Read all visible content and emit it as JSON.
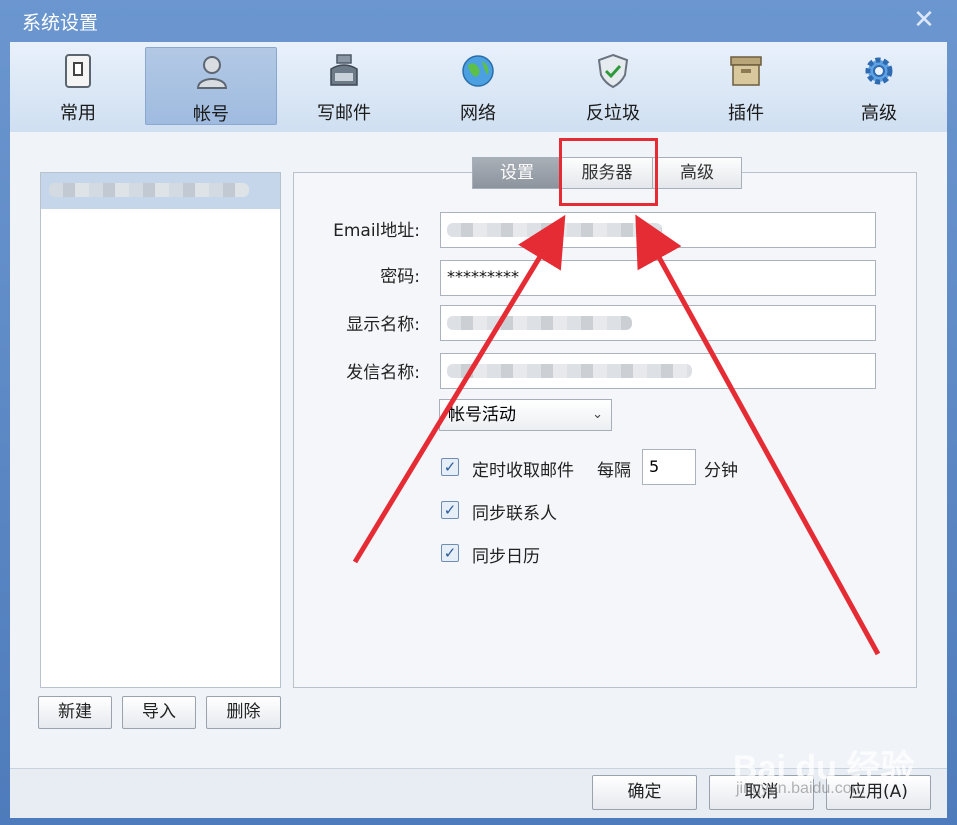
{
  "window": {
    "title": "系统设置",
    "close": "✕"
  },
  "toolbar": {
    "items": [
      {
        "label": "常用",
        "icon": "switch-icon"
      },
      {
        "label": "帐号",
        "icon": "person-icon"
      },
      {
        "label": "写邮件",
        "icon": "ink-bottle-icon"
      },
      {
        "label": "网络",
        "icon": "globe-icon"
      },
      {
        "label": "反垃圾",
        "icon": "shield-check-icon"
      },
      {
        "label": "插件",
        "icon": "box-icon"
      },
      {
        "label": "高级",
        "icon": "gear-icon"
      }
    ],
    "active_index": 1
  },
  "account_panel": {
    "buttons": {
      "new": "新建",
      "import": "导入",
      "delete": "删除"
    }
  },
  "tabs": [
    "设置",
    "服务器",
    "高级"
  ],
  "active_tab": 0,
  "form": {
    "email_label": "Email地址:",
    "password_label": "密码:",
    "password_value": "*********",
    "display_name_label": "显示名称:",
    "sender_name_label": "发信名称:",
    "account_status": "帐号活动",
    "check_fetch": "定时收取邮件",
    "interval_prefix": "每隔",
    "interval_value": "5",
    "interval_unit": "分钟",
    "check_contacts": "同步联系人",
    "check_calendar": "同步日历"
  },
  "footer": {
    "ok": "确定",
    "cancel": "取消",
    "apply": "应用(A)"
  },
  "watermark": {
    "text": "Bai du 经验",
    "sub": "jingyan.baidu.com"
  },
  "annotation_color": "#e52b33"
}
